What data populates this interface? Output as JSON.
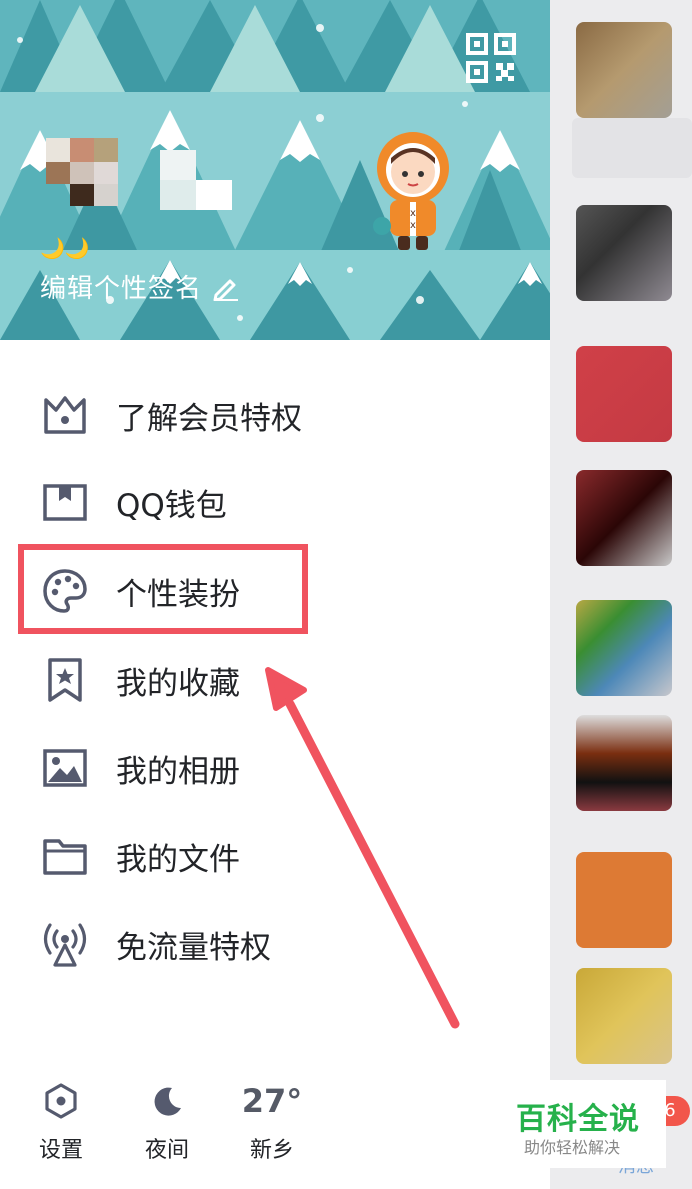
{
  "profile": {
    "signature_placeholder": "编辑个性签名",
    "level_badges": "🌙🌙"
  },
  "menu": [
    {
      "id": "vip",
      "label": "了解会员特权",
      "icon": "crown-icon"
    },
    {
      "id": "wallet",
      "label": "QQ钱包",
      "icon": "wallet-icon"
    },
    {
      "id": "theme",
      "label": "个性装扮",
      "icon": "palette-icon",
      "highlighted": true
    },
    {
      "id": "favorites",
      "label": "我的收藏",
      "icon": "bookmark-star-icon"
    },
    {
      "id": "album",
      "label": "我的相册",
      "icon": "image-icon"
    },
    {
      "id": "files",
      "label": "我的文件",
      "icon": "folder-icon"
    },
    {
      "id": "freeflow",
      "label": "免流量特权",
      "icon": "antenna-icon"
    }
  ],
  "bottom_bar": {
    "settings_label": "设置",
    "night_label": "夜间",
    "weather_temp": "27°",
    "weather_city": "新乡"
  },
  "background_tab": {
    "badge_count": "6",
    "tab_label": "消息"
  },
  "watermark": {
    "title": "百科全说",
    "subtitle": "助你轻松解决"
  },
  "colors": {
    "highlight": "#f0535f",
    "icon": "#555a6e",
    "header_bg": "#8ccfd3",
    "watermark_green": "#26b14b"
  }
}
